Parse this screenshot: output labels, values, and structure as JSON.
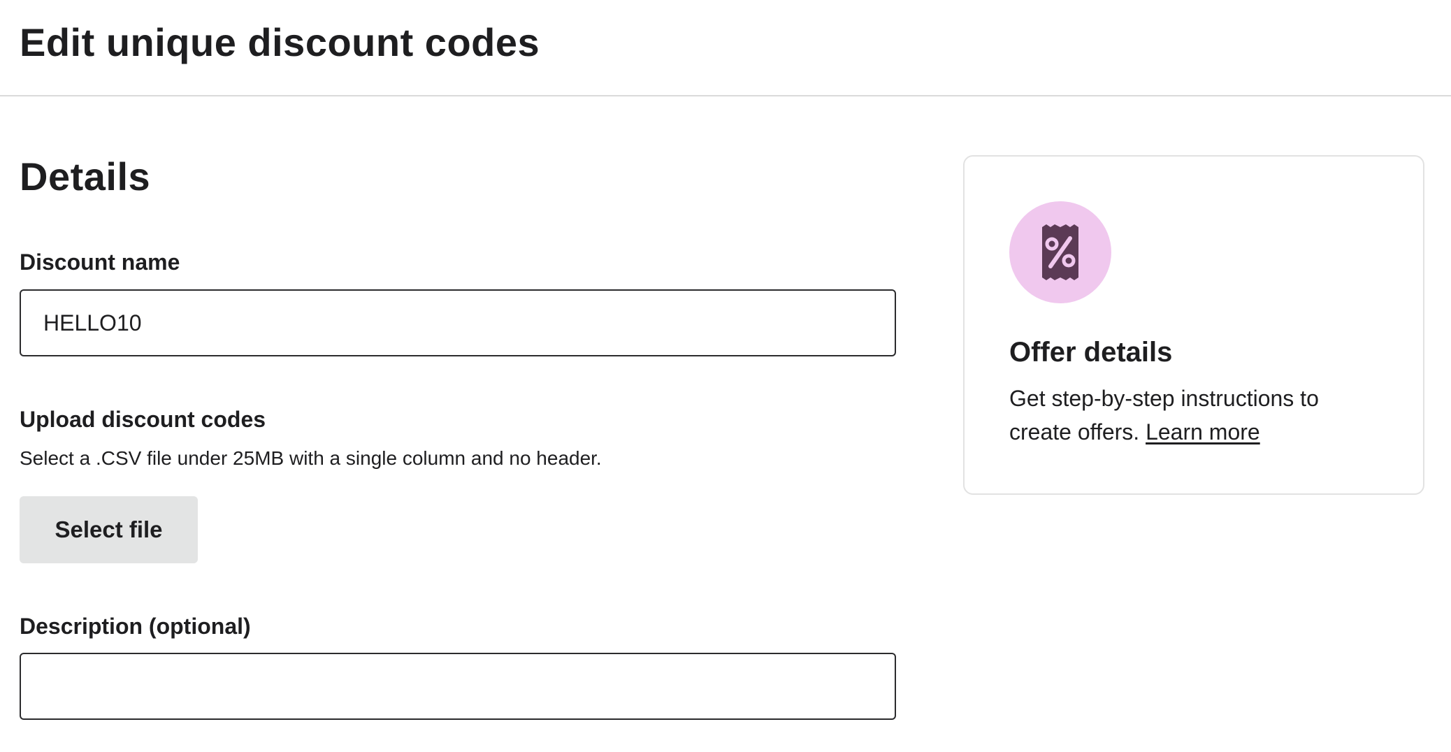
{
  "header": {
    "title": "Edit unique discount codes"
  },
  "details": {
    "title": "Details",
    "discount_name": {
      "label": "Discount name",
      "value": "HELLO10"
    },
    "upload": {
      "label": "Upload discount codes",
      "help": "Select a .CSV file under 25MB with a single column and no header.",
      "button_label": "Select file"
    },
    "description": {
      "label": "Description (optional)",
      "value": ""
    }
  },
  "offer_card": {
    "icon": "discount-ticket-icon",
    "title": "Offer details",
    "text": "Get step-by-step instructions to create offers.",
    "link_label": "Learn more"
  },
  "colors": {
    "icon_circle": "#f0c8ee",
    "icon_glyph": "#5b3a55",
    "button_bg": "#e3e4e4",
    "text": "#1e1e20"
  }
}
